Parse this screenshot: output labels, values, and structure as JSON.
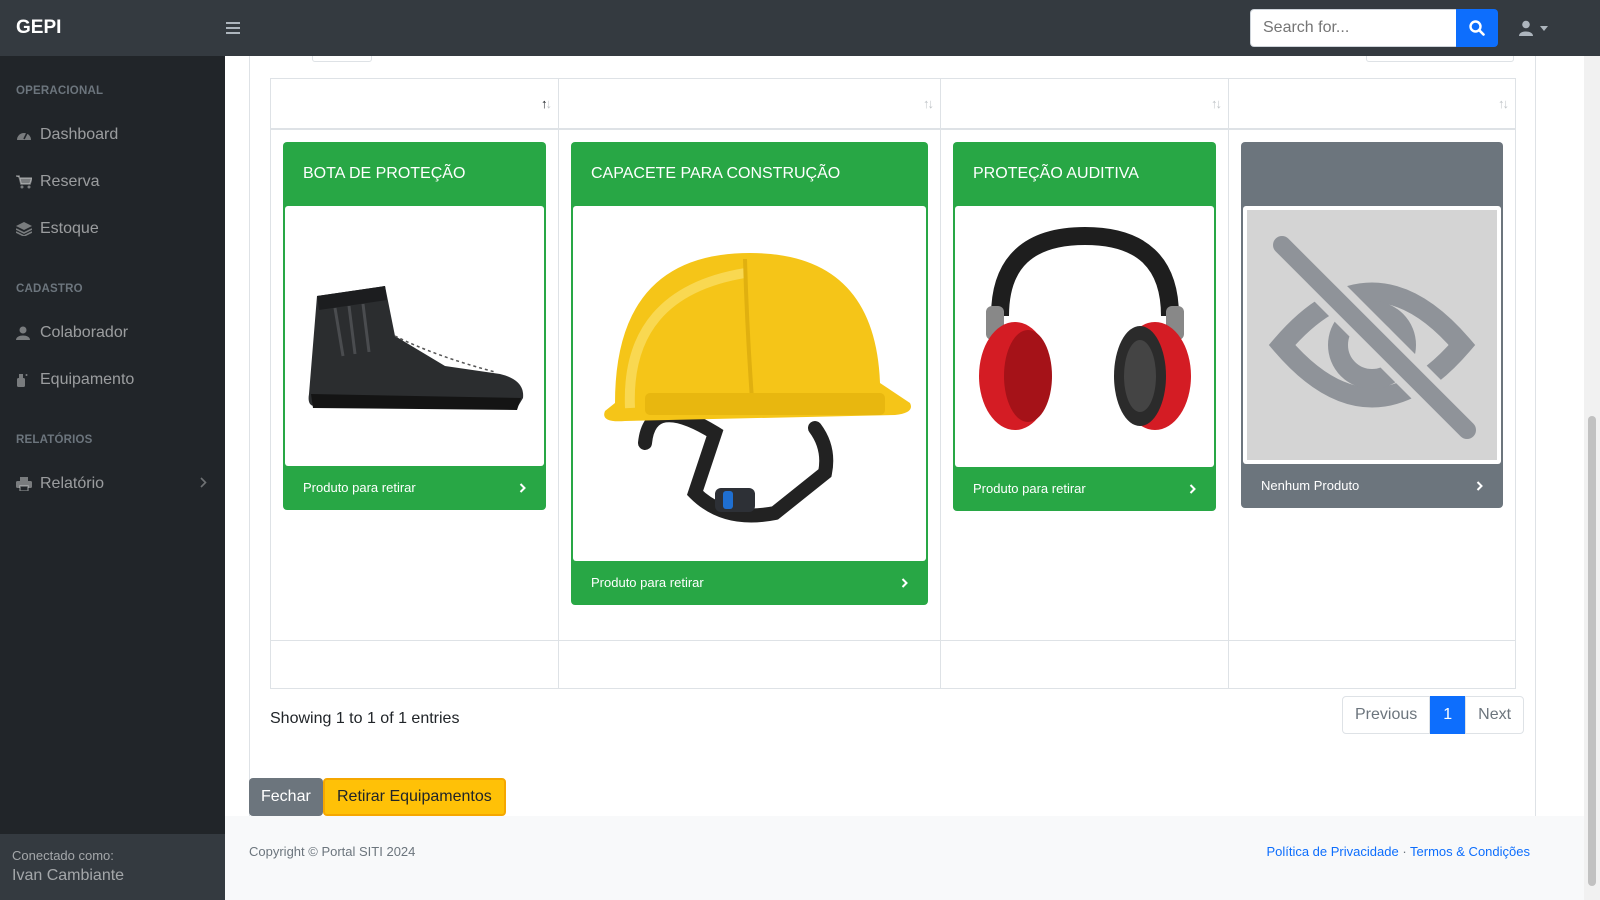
{
  "topnav": {
    "brand": "GEPI",
    "search_placeholder": "Search for..."
  },
  "sidebar": {
    "sections": [
      {
        "heading": "Operacional"
      },
      {
        "heading": "Cadastro"
      },
      {
        "heading": "Relatórios"
      }
    ],
    "items": [
      {
        "label": "Dashboard",
        "icon": "tachometer-icon"
      },
      {
        "label": "Reserva",
        "icon": "cart-icon"
      },
      {
        "label": "Estoque",
        "icon": "layers-icon"
      },
      {
        "label": "Colaborador",
        "icon": "user-icon"
      },
      {
        "label": "Equipamento",
        "icon": "spray-can-icon"
      },
      {
        "label": "Relatório",
        "icon": "print-icon"
      }
    ],
    "footer": {
      "label": "Conectado como:",
      "user": "Ivan Cambiante"
    }
  },
  "products": [
    {
      "title": "BOTA DE PROTEÇÃO",
      "footer": "Produto para retirar",
      "image": "boot-image",
      "status_color": "#28a745"
    },
    {
      "title": "CAPACETE PARA CONSTRUÇÃO",
      "footer": "Produto para retirar",
      "image": "helmet-image",
      "status_color": "#28a745"
    },
    {
      "title": "PROTEÇÃO AUDITIVA",
      "footer": "Produto para retirar",
      "image": "earmuffs-image",
      "status_color": "#28a745"
    },
    {
      "title": "",
      "footer": "Nenhum Produto",
      "image": "eye-slash-icon",
      "status_color": "#6c757d"
    }
  ],
  "table": {
    "showing": "Showing 1 to 1 of 1 entries",
    "pagination": {
      "previous": "Previous",
      "current": "1",
      "next": "Next"
    }
  },
  "actions": {
    "close": "Fechar",
    "withdraw": "Retirar Equipamentos"
  },
  "footer": {
    "copyright": "Copyright © Portal SITI 2024",
    "privacy": "Política de Privacidade",
    "separator": "·",
    "terms": "Termos & Condições"
  }
}
